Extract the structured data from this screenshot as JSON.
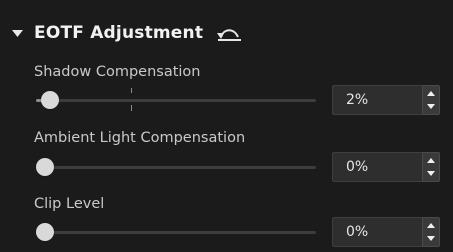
{
  "section": {
    "title": "EOTF Adjustment",
    "collapse_icon": "caret-down-icon",
    "reset_icon": "undo-arrow-icon"
  },
  "controls": [
    {
      "label": "Shadow Compensation",
      "value_text": "2%",
      "value": 2
    },
    {
      "label": "Ambient Light Compensation",
      "value_text": "0%",
      "value": 0
    },
    {
      "label": "Clip Level",
      "value_text": "0%",
      "value": 0
    }
  ],
  "colors": {
    "background": "#1b1b1b",
    "text": "#d2d2d2",
    "thumb": "#d9d9d9",
    "track": "#3d3d3d"
  }
}
